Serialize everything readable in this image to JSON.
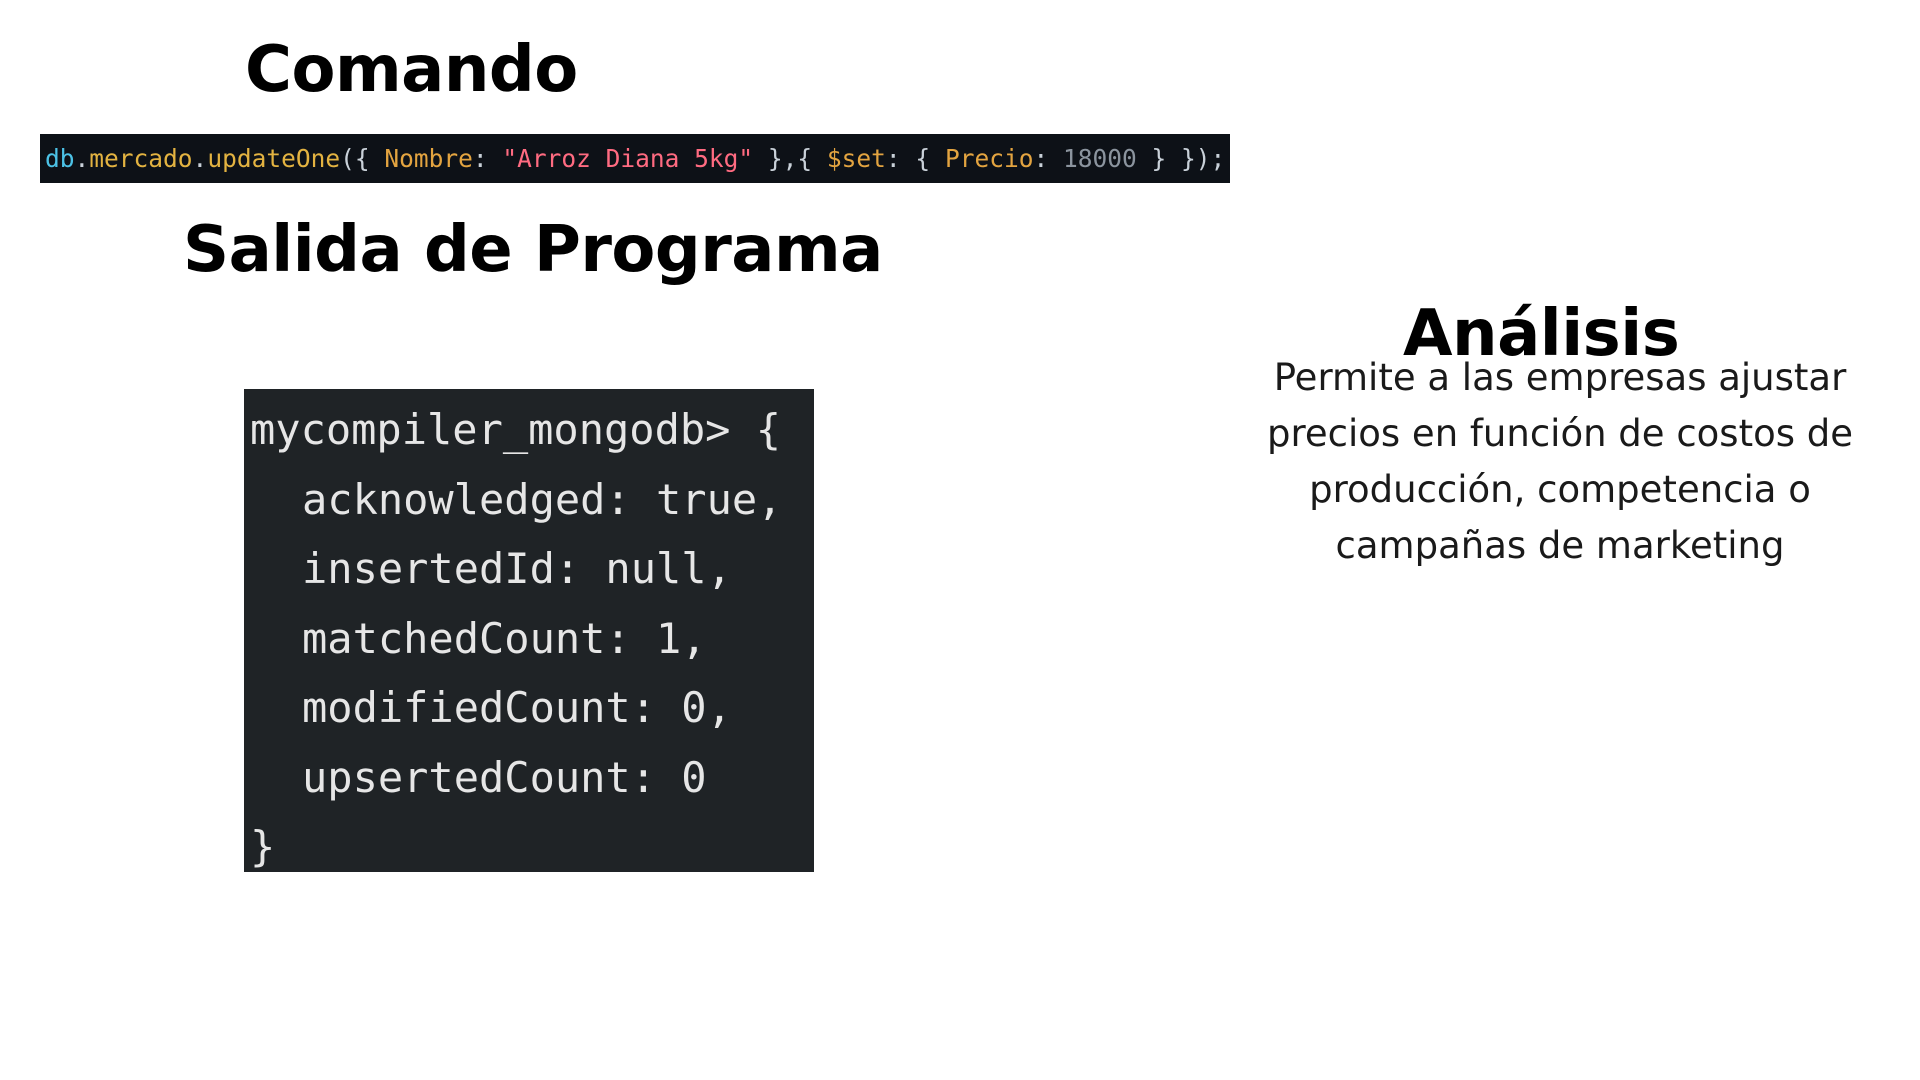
{
  "headings": {
    "command": "Comando",
    "output": "Salida de Programa",
    "analysis": "Análisis"
  },
  "command": {
    "tokens": {
      "db": "db",
      "dot1": ".",
      "collection": "mercado",
      "dot2": ".",
      "method": "updateOne",
      "open": "({ ",
      "key_nombre": "Nombre",
      "colon1": ": ",
      "value_nombre": "\"Arroz Diana 5kg\"",
      "mid": " },{ ",
      "key_set": "$set",
      "colon2": ": { ",
      "key_precio": "Precio",
      "colon3": ": ",
      "value_precio": "18000",
      "close": " } });"
    }
  },
  "output": {
    "lines": [
      "mycompiler_mongodb> {",
      "acknowledged: true,",
      "insertedId: null,",
      "matchedCount: 1,",
      "modifiedCount: 0,",
      "upsertedCount: 0",
      "}"
    ]
  },
  "analysis": {
    "text": "Permite a las empresas ajustar precios en función de costos de producción, competencia o campañas de marketing"
  },
  "colors": {
    "command_background": "#0d1117",
    "output_background": "#1f2326",
    "string_color": "#ff6b81",
    "key_color": "#e3a440"
  }
}
